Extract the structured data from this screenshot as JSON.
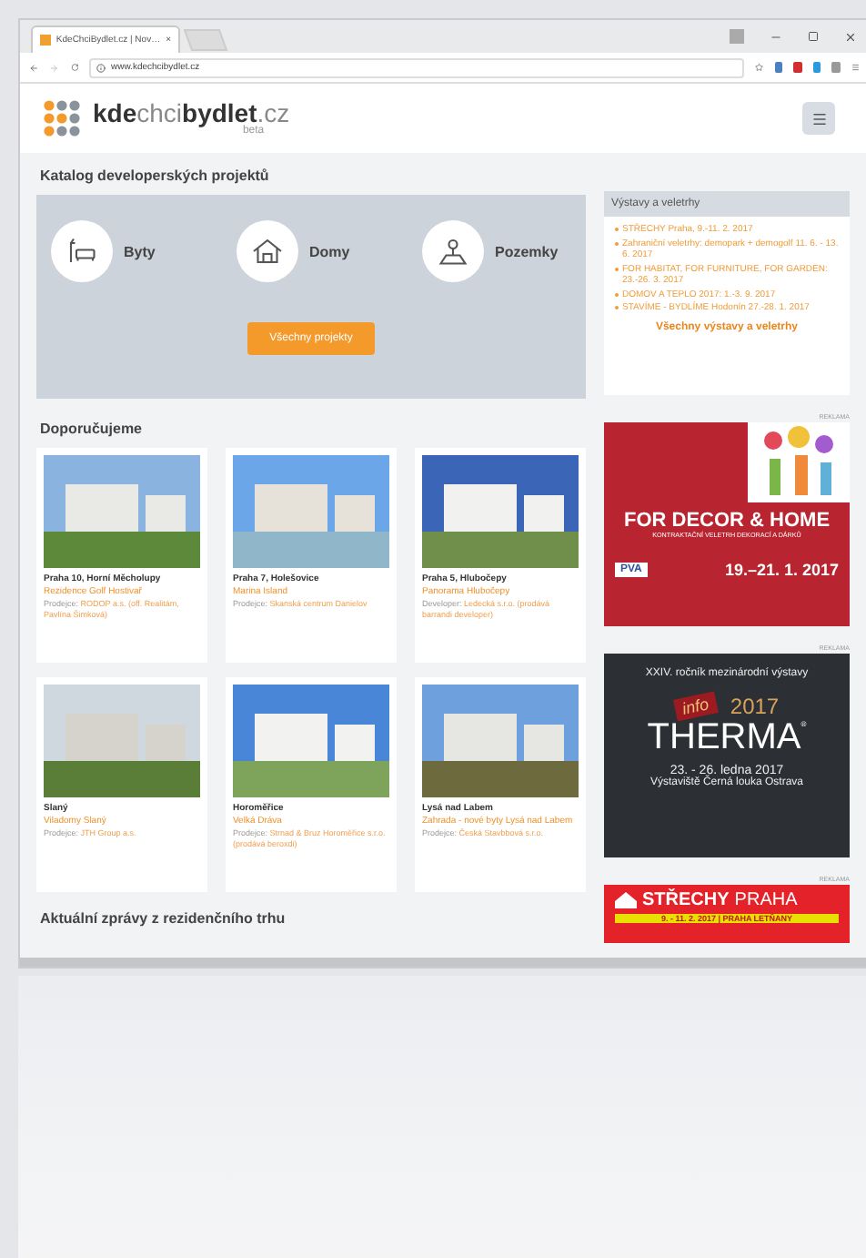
{
  "browser": {
    "tab_title": "KdeChciBydlet.cz | Nov…",
    "tab_close": "×",
    "url": "www.kdechcibydlet.cz"
  },
  "header": {
    "logo_parts": [
      {
        "text": "kde",
        "bold": true
      },
      {
        "text": "chci",
        "bold": false
      },
      {
        "text": "bydlet",
        "bold": true
      },
      {
        "text": ".cz",
        "bold": false
      }
    ],
    "logo_sub": "beta"
  },
  "catalog": {
    "title": "Katalog developerských projektů",
    "categories": [
      {
        "kind": "flat",
        "label": "Byty"
      },
      {
        "kind": "house",
        "label": "Domy"
      },
      {
        "kind": "land",
        "label": "Pozemky"
      }
    ],
    "button": "Všechny projekty"
  },
  "fairs": {
    "title": "Výstavy a veletrhy",
    "items": [
      "STŘECHY Praha, 9.-11. 2. 2017",
      "Zahraniční veletrhy: demopark + demogolf 11. 6. - 13. 6. 2017",
      "FOR HABITAT, FOR FURNITURE, FOR GARDEN: 23.-26. 3. 2017",
      "DOMOV A TEPLO 2017: 1.-3. 9. 2017",
      "STAVÍME - BYDLÍME Hodonín 27.-28. 1. 2017"
    ],
    "link": "Všechny výstavy a veletrhy"
  },
  "recommended": {
    "title": "Doporučujeme",
    "projects": [
      {
        "place": "Praha 10, Horní Měcholupy",
        "name": "Rezidence Golf Hostivař",
        "seller_label": "Prodejce:",
        "seller": "RODOP a.s. (off. Realitám, Pavlína Šimková)"
      },
      {
        "place": "Praha 7, Holešovice",
        "name": "Marina Island",
        "seller_label": "Prodejce:",
        "seller": "Skanská centrum Danielov"
      },
      {
        "place": "Praha 5, Hlubočepy",
        "name": "Panorama Hlubočepy",
        "seller_label": "Developer:",
        "seller": "Ledecká s.r.o. (prodává barrandi developer)"
      },
      {
        "place": "Slaný",
        "name": "Viladomy Slaný",
        "seller_label": "Prodejce:",
        "seller": "JTH Group a.s."
      },
      {
        "place": "Horoměřice",
        "name": "Velká Dráva",
        "seller_label": "Prodejce:",
        "seller": "Strnad & Bruz Horoměřice s.r.o. (prodává beroxdi)"
      },
      {
        "place": "Lysá nad Labem",
        "name": "Zahrada - nové byty Lysá nad Labem",
        "seller_label": "Prodejce:",
        "seller": "Česká Stavbbová s.r.o."
      }
    ]
  },
  "news": {
    "title": "Aktuální zprávy z rezidenčního trhu"
  },
  "ads": [
    {
      "kind": "decor",
      "label": "REKLAMA",
      "headline": "FOR DECOR & HOME",
      "subline": "KONTRAKTAČNÍ VELETRH DEKORACÍ A DÁRKŮ",
      "brand": "PVA",
      "dates": "19.–21. 1. 2017"
    },
    {
      "kind": "therma",
      "label": "REKLAMA",
      "top": "XXIV. ročník mezinárodní výstavy",
      "badge": "info",
      "year": "2017",
      "headline": "THERMA",
      "mark": "®",
      "dates": "23. - 26. ledna 2017",
      "venue": "Výstaviště Černá louka Ostrava"
    },
    {
      "kind": "roof",
      "label": "REKLAMA",
      "headline": "STŘECHY",
      "city": "PRAHA",
      "dates": "9. - 11. 2. 2017 | PRAHA LETŇANY"
    }
  ]
}
